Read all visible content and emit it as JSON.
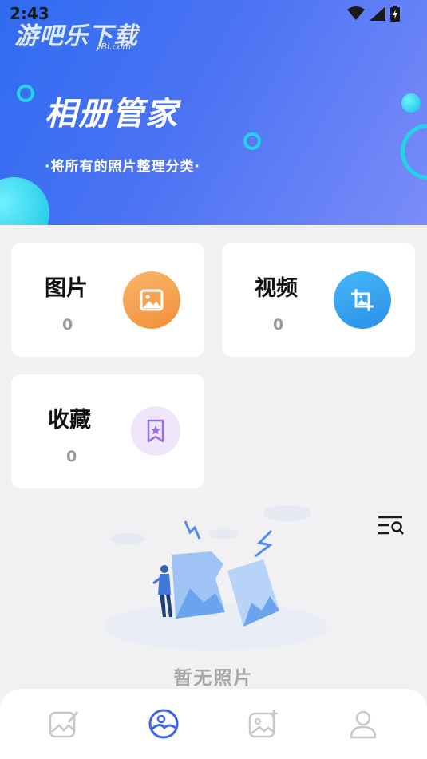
{
  "status_bar": {
    "time": "2:43"
  },
  "watermark": {
    "text": "游吧乐下载",
    "sub": "yBl.com"
  },
  "hero": {
    "title": "相册管家",
    "subtitle": "·将所有的照片整理分类·"
  },
  "cards": [
    {
      "label": "图片",
      "count": "0",
      "icon": "image-icon",
      "color": "#f5a04e"
    },
    {
      "label": "视频",
      "count": "0",
      "icon": "video-icon",
      "color": "#3aa6f2"
    },
    {
      "label": "收藏",
      "count": "0",
      "icon": "bookmark-star-icon",
      "color": "#9b6fe0"
    }
  ],
  "empty_state": {
    "text": "暂无照片"
  },
  "bottom_nav": {
    "items": [
      {
        "icon": "edit-photo-icon",
        "active": false
      },
      {
        "icon": "album-icon",
        "active": true
      },
      {
        "icon": "add-photo-icon",
        "active": false
      },
      {
        "icon": "profile-icon",
        "active": false
      }
    ],
    "active_color": "#3b63f0",
    "inactive_color": "#c8c8c8"
  },
  "colors": {
    "hero_start": "#2f6bf0",
    "hero_end": "#7a8cf8",
    "accent": "#22d4e6"
  }
}
